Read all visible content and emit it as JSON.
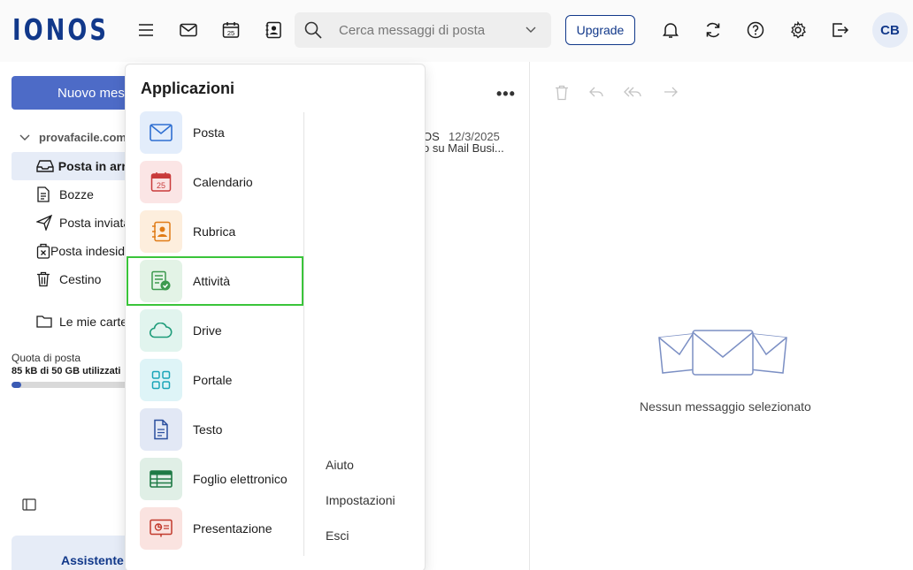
{
  "brand": {
    "logo_text": "IONOS",
    "accent": "#11388a",
    "button_blue": "#4d6bc7"
  },
  "header": {
    "search_placeholder": "Cerca messaggi di posta",
    "upgrade_label": "Upgrade",
    "avatar_initials": "CB",
    "icons": [
      "menu-icon",
      "mail-icon",
      "calendar-icon",
      "contacts-icon",
      "bell-icon",
      "sync-icon",
      "help-icon",
      "settings-icon",
      "logout-icon"
    ]
  },
  "calendar_icon_day": "25",
  "sidebar": {
    "new_message_label": "Nuovo messaggio",
    "account": "provafacile.com",
    "folders": [
      {
        "label": "Posta in arrivo",
        "icon": "inbox-icon",
        "active": true
      },
      {
        "label": "Bozze",
        "icon": "draft-icon"
      },
      {
        "label": "Posta inviata",
        "icon": "send-icon"
      },
      {
        "label": "Posta indesiderata",
        "icon": "spam-icon"
      },
      {
        "label": "Cestino",
        "icon": "trash-icon"
      },
      {
        "label": "Le mie cartelle",
        "icon": "folder-icon"
      }
    ],
    "quota_label": "Quota di posta",
    "quota_value": "85 kB di 50 GB utilizzati",
    "quota_fraction": 0.08,
    "assistant_label": "Assistente"
  },
  "message_list": {
    "sender_fragment": "OS",
    "date": "12/3/2025",
    "subject_fragment": "o su Mail Busi..."
  },
  "reading_pane": {
    "empty_text": "Nessun messaggio selezionato"
  },
  "apps_menu": {
    "title": "Applicazioni",
    "apps": [
      {
        "label": "Posta",
        "icon": "mail-app-icon",
        "color": "#2f6fd1"
      },
      {
        "label": "Calendario",
        "icon": "calendar-app-icon",
        "color": "#c93b3b"
      },
      {
        "label": "Rubrica",
        "icon": "contacts-app-icon",
        "color": "#e07b16"
      },
      {
        "label": "Attività",
        "icon": "tasks-app-icon",
        "color": "#3c9a4e",
        "highlighted": true
      },
      {
        "label": "Drive",
        "icon": "drive-app-icon",
        "color": "#1e9c7a"
      },
      {
        "label": "Portale",
        "icon": "portal-app-icon",
        "color": "#1aa5b8"
      },
      {
        "label": "Testo",
        "icon": "text-app-icon",
        "color": "#2b4f9e"
      },
      {
        "label": "Foglio elettronico",
        "icon": "spreadsheet-app-icon",
        "color": "#1e7a45"
      },
      {
        "label": "Presentazione",
        "icon": "presentation-app-icon",
        "color": "#c23a2c"
      }
    ],
    "links": [
      "Aiuto",
      "Impostazioni",
      "Esci"
    ]
  }
}
